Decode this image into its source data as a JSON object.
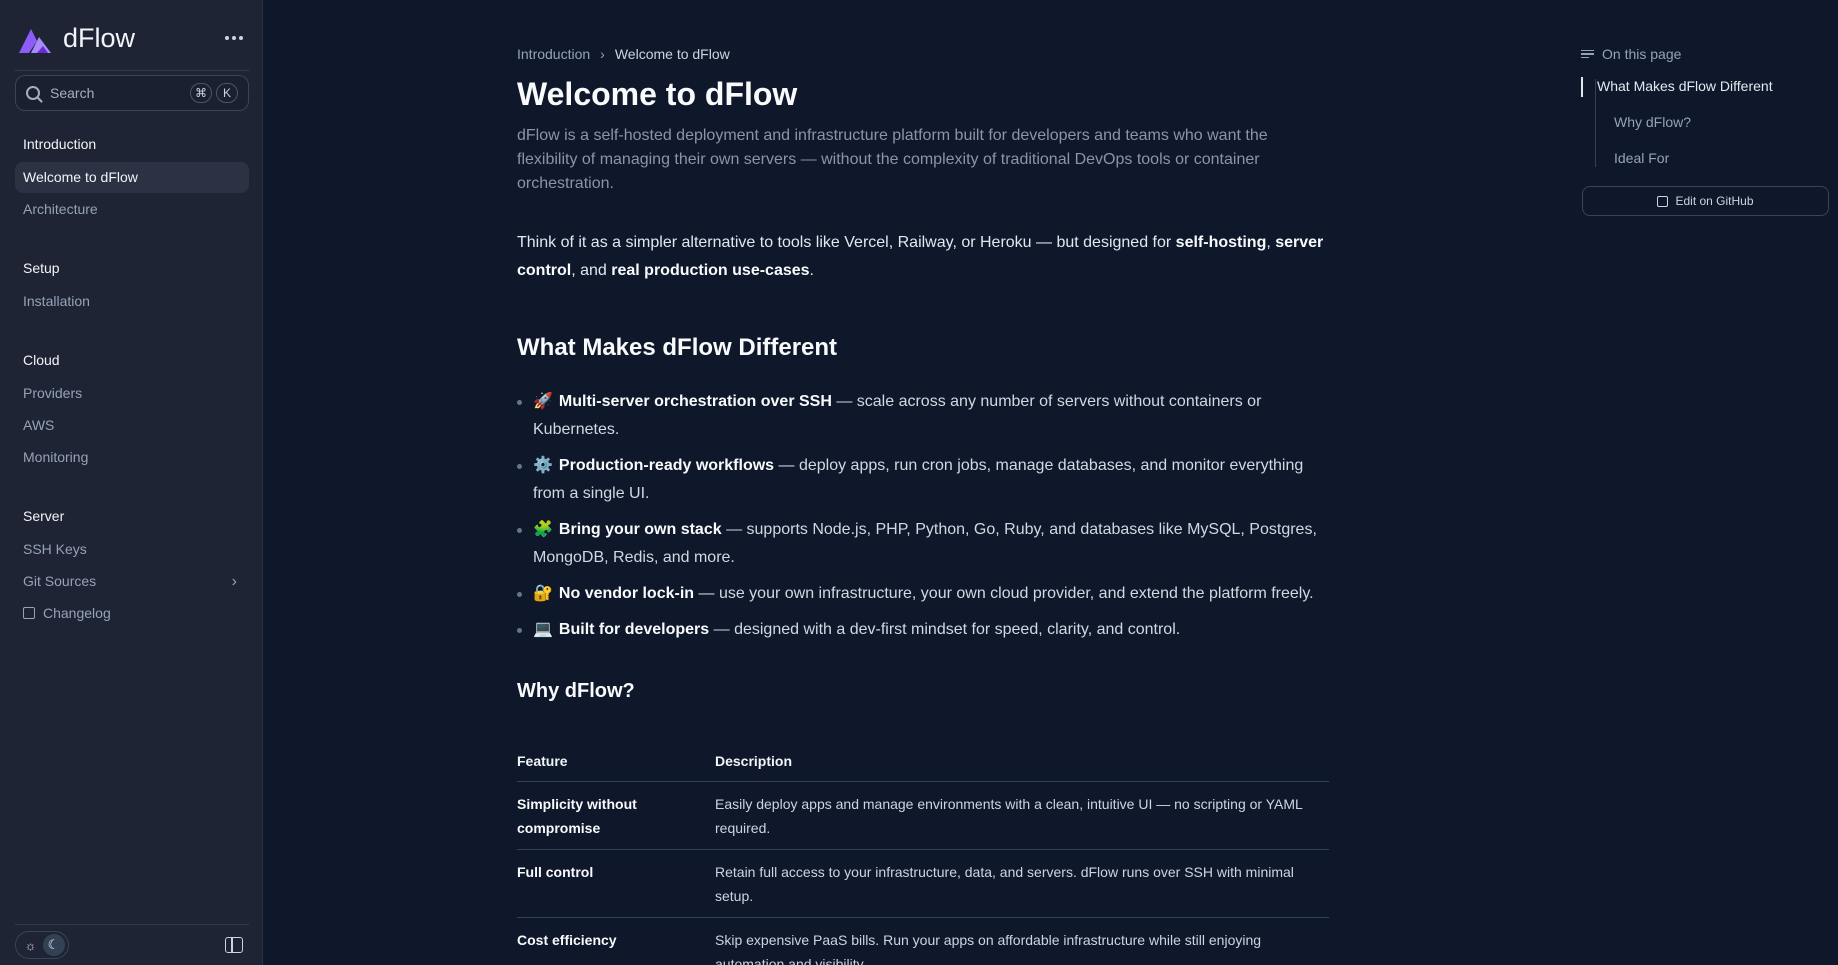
{
  "app": {
    "name": "dFlow"
  },
  "search": {
    "placeholder": "Search",
    "shortcut_mod": "⌘",
    "shortcut_key": "K"
  },
  "sidebar": {
    "sections": [
      {
        "title": "Introduction",
        "items": [
          {
            "label": "Welcome to dFlow",
            "active": true
          },
          {
            "label": "Architecture"
          }
        ]
      },
      {
        "title": "Setup",
        "items": [
          {
            "label": "Installation"
          }
        ]
      },
      {
        "title": "Cloud",
        "items": [
          {
            "label": "Providers"
          },
          {
            "label": "AWS"
          },
          {
            "label": "Monitoring"
          }
        ]
      },
      {
        "title": "Server",
        "items": [
          {
            "label": "SSH Keys"
          },
          {
            "label": "Git Sources"
          },
          {
            "label": "Changelog"
          }
        ]
      }
    ]
  },
  "breadcrumb": {
    "parent": "Introduction",
    "current": "Welcome to dFlow"
  },
  "page": {
    "title": "Welcome to dFlow",
    "lead": "dFlow is a self-hosted deployment and infrastructure platform built for developers and teams who want the flexibility of managing their own servers — without the complexity of traditional DevOps tools or container orchestration.",
    "intro": {
      "t1": "Think of it as a simpler alternative to tools like Vercel, Railway, or Heroku — but designed for ",
      "b1": "self-hosting",
      "t2": ", ",
      "b2": "server control",
      "t3": ", and ",
      "b3": "real production use-cases",
      "t4": "."
    },
    "section1_title": "What Makes dFlow Different",
    "features": [
      {
        "emoji": "🚀",
        "title": "Multi-server orchestration over SSH",
        "text": " — scale across any number of servers without containers or Kubernetes."
      },
      {
        "emoji": "⚙️",
        "title": "Production-ready workflows",
        "text": " — deploy apps, run cron jobs, manage databases, and monitor everything from a single UI."
      },
      {
        "emoji": "🧩",
        "title": "Bring your own stack",
        "text": " — supports Node.js, PHP, Python, Go, Ruby, and databases like MySQL, Postgres, MongoDB, Redis, and more."
      },
      {
        "emoji": "🔐",
        "title": "No vendor lock-in",
        "text": " — use your own infrastructure, your own cloud provider, and extend the platform freely."
      },
      {
        "emoji": "💻",
        "title": "Built for developers",
        "text": " — designed with a dev-first mindset for speed, clarity, and control."
      }
    ],
    "section2_title": "Why dFlow?",
    "table": {
      "headers": [
        "Feature",
        "Description"
      ],
      "rows": [
        [
          "Simplicity without compromise",
          "Easily deploy apps and manage environments with a clean, intuitive UI — no scripting or YAML required."
        ],
        [
          "Full control",
          "Retain full access to your infrastructure, data, and servers. dFlow runs over SSH with minimal setup."
        ],
        [
          "Cost efficiency",
          "Skip expensive PaaS bills. Run your apps on affordable infrastructure while still enjoying automation and visibility."
        ]
      ]
    }
  },
  "toc": {
    "title": "On this page",
    "items": [
      "What Makes dFlow Different",
      "Why dFlow?",
      "Ideal For"
    ],
    "edit_label": "Edit on GitHub"
  },
  "colors": {
    "background": "#0f172a",
    "sidebar": "#1e2433",
    "accent": "#8b5cf6"
  },
  "icons": {
    "logo": "dflow-logo-icon",
    "more": "more-horizontal-icon",
    "search": "search-icon",
    "external": "external-link-icon",
    "chevron": "chevron-right-icon",
    "sun": "sun-icon",
    "moon": "moon-icon",
    "sidebar_toggle": "sidebar-toggle-icon",
    "toc": "list-icon",
    "edit": "pencil-icon"
  }
}
